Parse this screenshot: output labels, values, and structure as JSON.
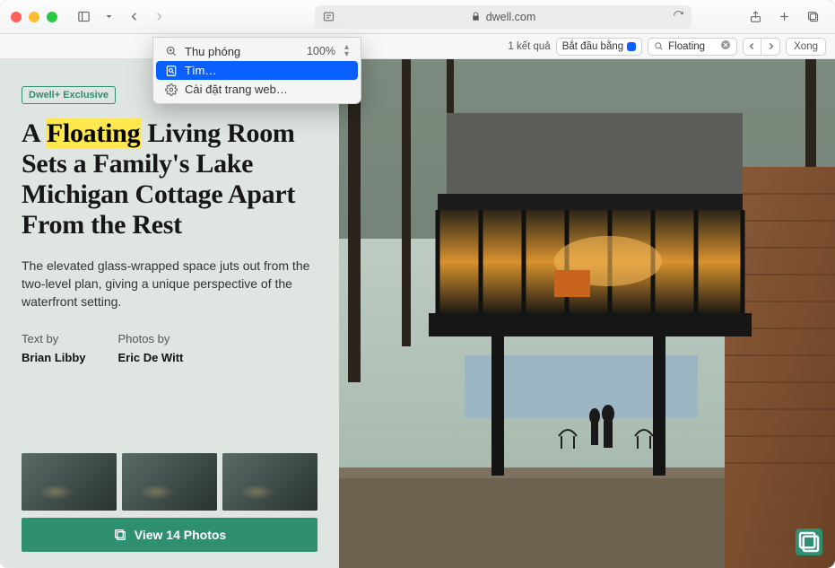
{
  "browser": {
    "url_host": "dwell.com"
  },
  "dropdown": {
    "zoom_label": "Thu phóng",
    "zoom_value": "100%",
    "find_label": "Tìm…",
    "settings_label": "Cài đặt trang web…"
  },
  "findbar": {
    "result_count": "1 kết quả",
    "mode_label": "Bắt đầu bằng",
    "query": "Floating",
    "done_label": "Xong"
  },
  "article": {
    "badge": "Dwell+ Exclusive",
    "headline_pre": "A ",
    "headline_hl": "Floating",
    "headline_post": " Living Room Sets a Family's Lake Michigan Cottage Apart From the Rest",
    "deck": "The elevated glass-wrapped space juts out from the two-level plan, giving a unique perspective of the waterfront setting.",
    "text_by_label": "Text by",
    "text_by": "Brian Libby",
    "photos_by_label": "Photos by",
    "photos_by": "Eric De Witt",
    "view_photos_label": "View 14 Photos"
  }
}
